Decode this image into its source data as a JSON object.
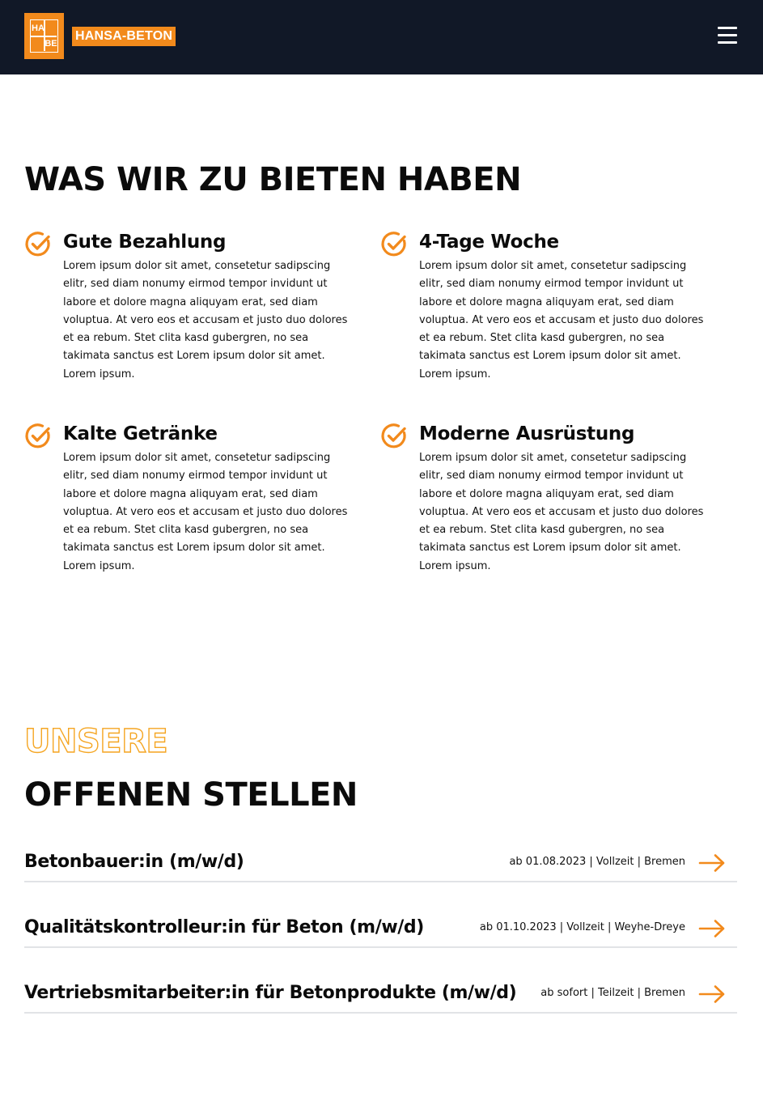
{
  "header": {
    "logo_cells": [
      "HA",
      "BE"
    ],
    "brand_name": "HANSA-BETON",
    "menu_icon": "hamburger-menu-icon"
  },
  "colors": {
    "accent": "#f28a1c",
    "header_bg": "#111827",
    "text": "#0b0b0b",
    "divider": "#e1e3e6"
  },
  "benefits": {
    "title": "WAS WIR ZU BIETEN HABEN",
    "icon": "check-circle-icon",
    "items": [
      {
        "title": "Gute Bezahlung",
        "text": "Lorem ipsum dolor sit amet, consetetur sadipscing elitr, sed diam nonumy eirmod tempor invidunt ut labore et dolore magna aliquyam erat, sed diam voluptua. At vero eos et accusam et justo duo dolores et ea rebum. Stet clita kasd gubergren, no sea takimata sanctus est Lorem ipsum dolor sit amet. Lorem ipsum."
      },
      {
        "title": "4-Tage Woche",
        "text": "Lorem ipsum dolor sit amet, consetetur sadipscing elitr, sed diam nonumy eirmod tempor invidunt ut labore et dolore magna aliquyam erat, sed diam voluptua. At vero eos et accusam et justo duo dolores et ea rebum. Stet clita kasd gubergren, no sea takimata sanctus est Lorem ipsum dolor sit amet. Lorem ipsum."
      },
      {
        "title": "Kalte Getränke",
        "text": "Lorem ipsum dolor sit amet, consetetur sadipscing elitr, sed diam nonumy eirmod tempor invidunt ut labore et dolore magna aliquyam erat, sed diam voluptua. At vero eos et accusam et justo duo dolores et ea rebum. Stet clita kasd gubergren, no sea takimata sanctus est Lorem ipsum dolor sit amet. Lorem ipsum."
      },
      {
        "title": "Moderne Ausrüstung",
        "text": "Lorem ipsum dolor sit amet, consetetur sadipscing elitr, sed diam nonumy eirmod tempor invidunt ut labore et dolore magna aliquyam erat, sed diam voluptua. At vero eos et accusam et justo duo dolores et ea rebum. Stet clita kasd gubergren, no sea takimata sanctus est Lorem ipsum dolor sit amet. Lorem ipsum."
      }
    ]
  },
  "jobs": {
    "kicker": "UNSERE",
    "title": "OFFENEN STELLEN",
    "arrow_icon": "arrow-right-icon",
    "items": [
      {
        "title": "Betonbauer:in (m/w/d)",
        "meta": "ab 01.08.2023 | Vollzeit | Bremen"
      },
      {
        "title": "Qualitätskontrolleur:in für Beton (m/w/d)",
        "meta": "ab 01.10.2023 | Vollzeit | Weyhe-Dreye"
      },
      {
        "title": "Vertriebsmitarbeiter:in für Betonprodukte (m/w/d)",
        "meta": "ab sofort | Teilzeit | Bremen"
      }
    ]
  }
}
